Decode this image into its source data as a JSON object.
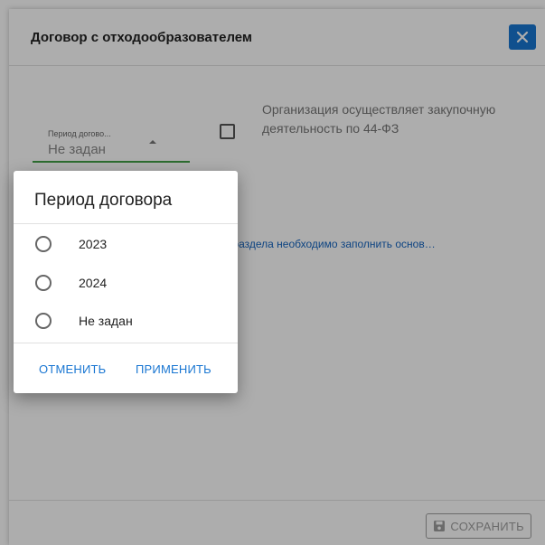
{
  "dialog": {
    "title": "Договор с отходообразователем",
    "close_icon": "close-icon"
  },
  "form": {
    "period_field": {
      "label": "Период догово...",
      "value": "Не задан"
    },
    "procurement_checkbox": {
      "checked": false,
      "label": "Организация осуществляет закупочную деятельность по 44-ФЗ"
    },
    "info_message": "ного раздела необходимо заполнить основ…"
  },
  "footer": {
    "save_label": "СОХРАНИТЬ",
    "save_icon": "save-icon"
  },
  "period_popup": {
    "title": "Период договора",
    "options": [
      {
        "label": "2023",
        "selected": false
      },
      {
        "label": "2024",
        "selected": false
      },
      {
        "label": "Не задан",
        "selected": false
      }
    ],
    "cancel_label": "ОТМЕНИТЬ",
    "apply_label": "ПРИМЕНИТЬ"
  },
  "colors": {
    "accent": "#1976d2",
    "field_active": "#43a047",
    "link": "#1565c0"
  }
}
